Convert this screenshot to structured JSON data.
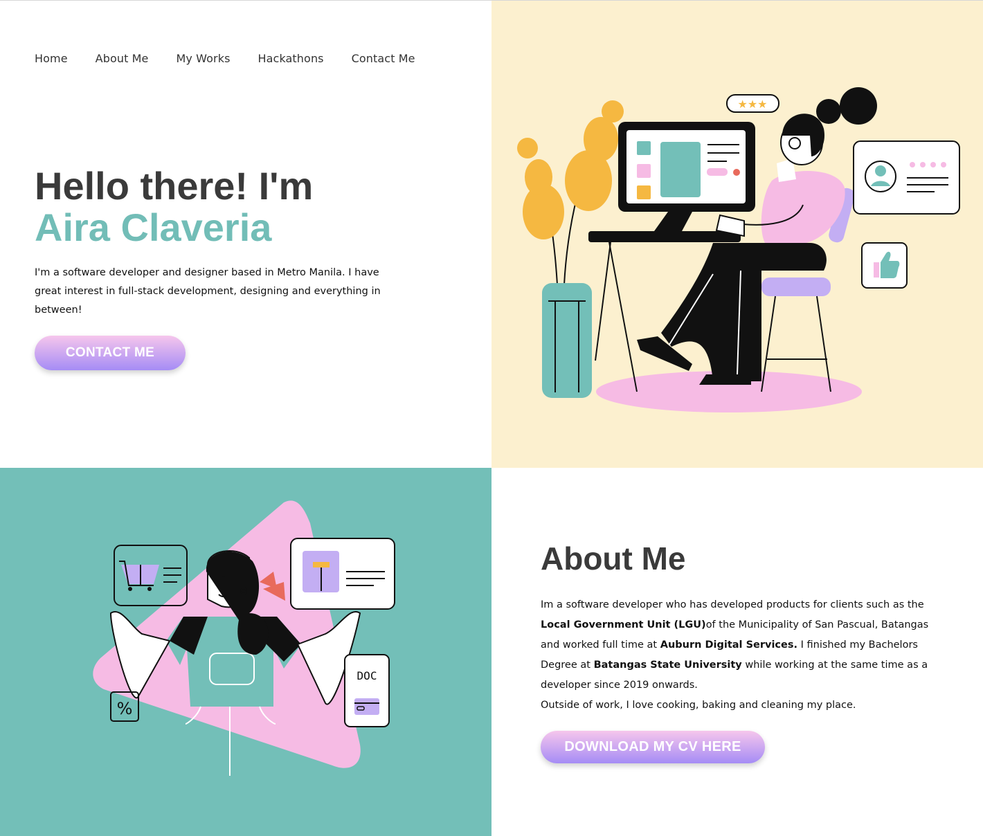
{
  "nav": {
    "items": [
      "Home",
      "About Me",
      "My Works",
      "Hackathons",
      "Contact Me"
    ]
  },
  "hero": {
    "greeting": "Hello there! I'm",
    "name": "Aira Claveria",
    "description": "I'm a software developer and designer based in Metro Manila. I have great interest in full-stack development, designing and everything in between!",
    "cta_label": "CONTACT ME"
  },
  "about": {
    "title": "About Me",
    "p1": "Im a software developer who has developed products for clients such as the ",
    "lgu": "Local Government Unit (LGU)",
    "p2": "of the Municipality of San Pascual, Batangas and worked full time at ",
    "company": "Auburn Digital Services.",
    "p3": " I finished my Bachelors Degree at ",
    "university": "Batangas State University",
    "p4": " while working at the same time as a developer since 2019 onwards.",
    "p5": "Outside of work, I love cooking, baking and cleaning my place.",
    "cv_label": "DOWNLOAD MY CV HERE"
  },
  "illustrations": {
    "doc_label": "DOC",
    "percent_label": "%"
  },
  "colors": {
    "teal": "#73bfb8",
    "cream": "#fcf0cf",
    "pink": "#f6bbe4",
    "purple": "#a58cf5",
    "orange": "#f5b841",
    "dark": "#3a3a3a"
  }
}
